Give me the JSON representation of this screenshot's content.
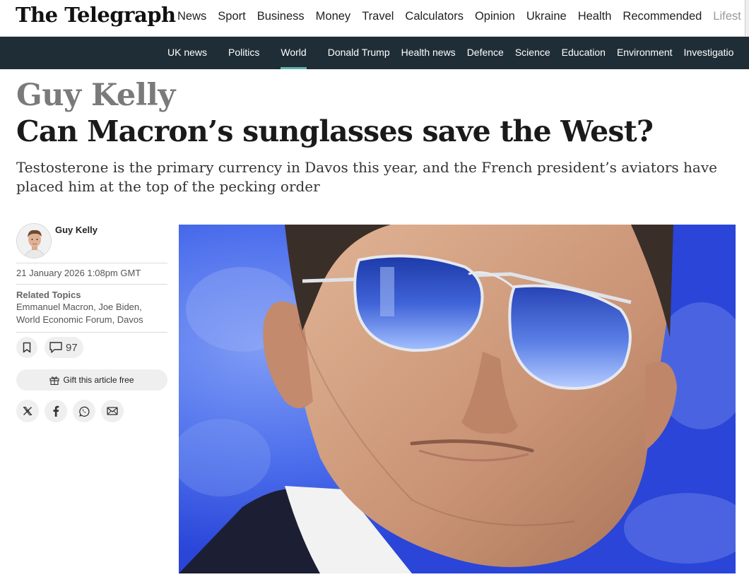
{
  "brand": {
    "logo_text": "The Telegraph"
  },
  "primary_nav": {
    "items": [
      "News",
      "Sport",
      "Business",
      "Money",
      "Travel",
      "Calculators",
      "Opinion",
      "Ukraine",
      "Health",
      "Recommended",
      "Lifest"
    ],
    "active": "News"
  },
  "secondary_nav": {
    "items": [
      "UK news",
      "Politics",
      "World",
      "Donald Trump",
      "Health news",
      "Defence",
      "Science",
      "Education",
      "Environment",
      "Investigatio"
    ],
    "active": "World"
  },
  "article": {
    "author_heading": "Guy Kelly",
    "headline": "Can Macron’s sunglasses save the West?",
    "standfirst": "Testosterone is the primary currency in Davos this year, and the French president’s aviators have placed him at the top of the pecking order",
    "byline_name": "Guy Kelly",
    "published": "21 January 2026 1:08pm GMT",
    "related_topics_label": "Related Topics",
    "related_topics": "Emmanuel Macron, Joe Biden, World Economic Forum, Davos",
    "comment_count": "97",
    "gift_label": "Gift this article free"
  },
  "icons": {
    "bookmark": "bookmark-icon",
    "comment": "comment-icon",
    "gift": "gift-icon",
    "share": [
      "x-icon",
      "facebook-icon",
      "whatsapp-icon",
      "email-icon"
    ]
  },
  "colors": {
    "nav_dark": "#1f2d36",
    "accent": "#5fb3ac",
    "hero_background": "#2d4fe0"
  }
}
